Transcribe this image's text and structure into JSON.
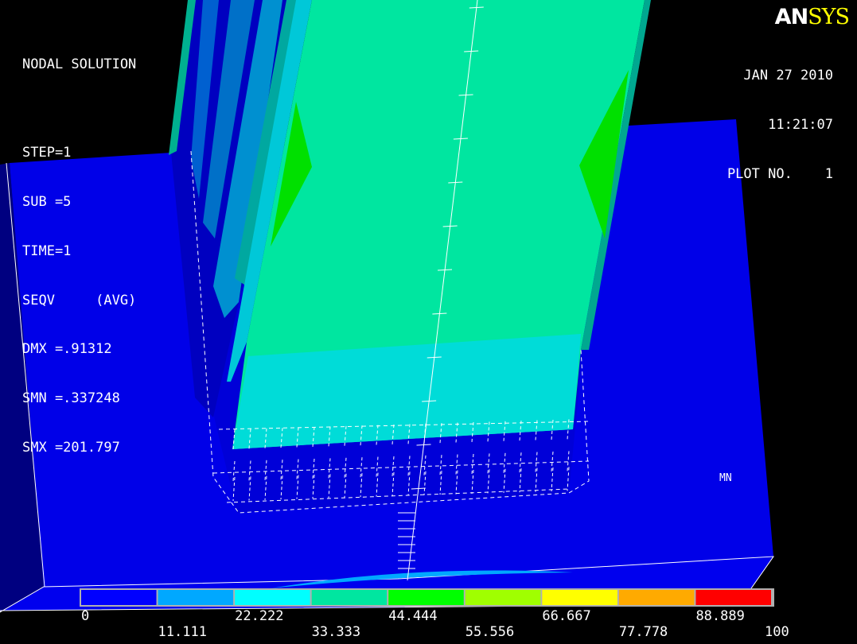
{
  "info": {
    "title": "NODAL SOLUTION",
    "step": "STEP=1",
    "sub": "SUB =5",
    "time": "TIME=1",
    "seqv": "SEQV     (AVG)",
    "dmx": "DMX =.91312",
    "smn": "SMN =.337248",
    "smx": "SMX =201.797"
  },
  "stamp": {
    "date": "JAN 27 2010",
    "time": "11:21:07",
    "plot": "PLOT NO.    1"
  },
  "logo": {
    "an": "AN",
    "sys": "SYS"
  },
  "marker": "MN",
  "legend": {
    "colors": [
      "#0000ff",
      "#00a8ff",
      "#00ffff",
      "#00e6a0",
      "#00ff00",
      "#a0ff00",
      "#ffff00",
      "#ffaa00",
      "#ff0000"
    ],
    "top_labels": [
      "0",
      "22.222",
      "44.444",
      "66.667",
      "88.889"
    ],
    "bottom_labels": [
      "11.111",
      "33.333",
      "55.556",
      "77.778",
      "100"
    ]
  }
}
